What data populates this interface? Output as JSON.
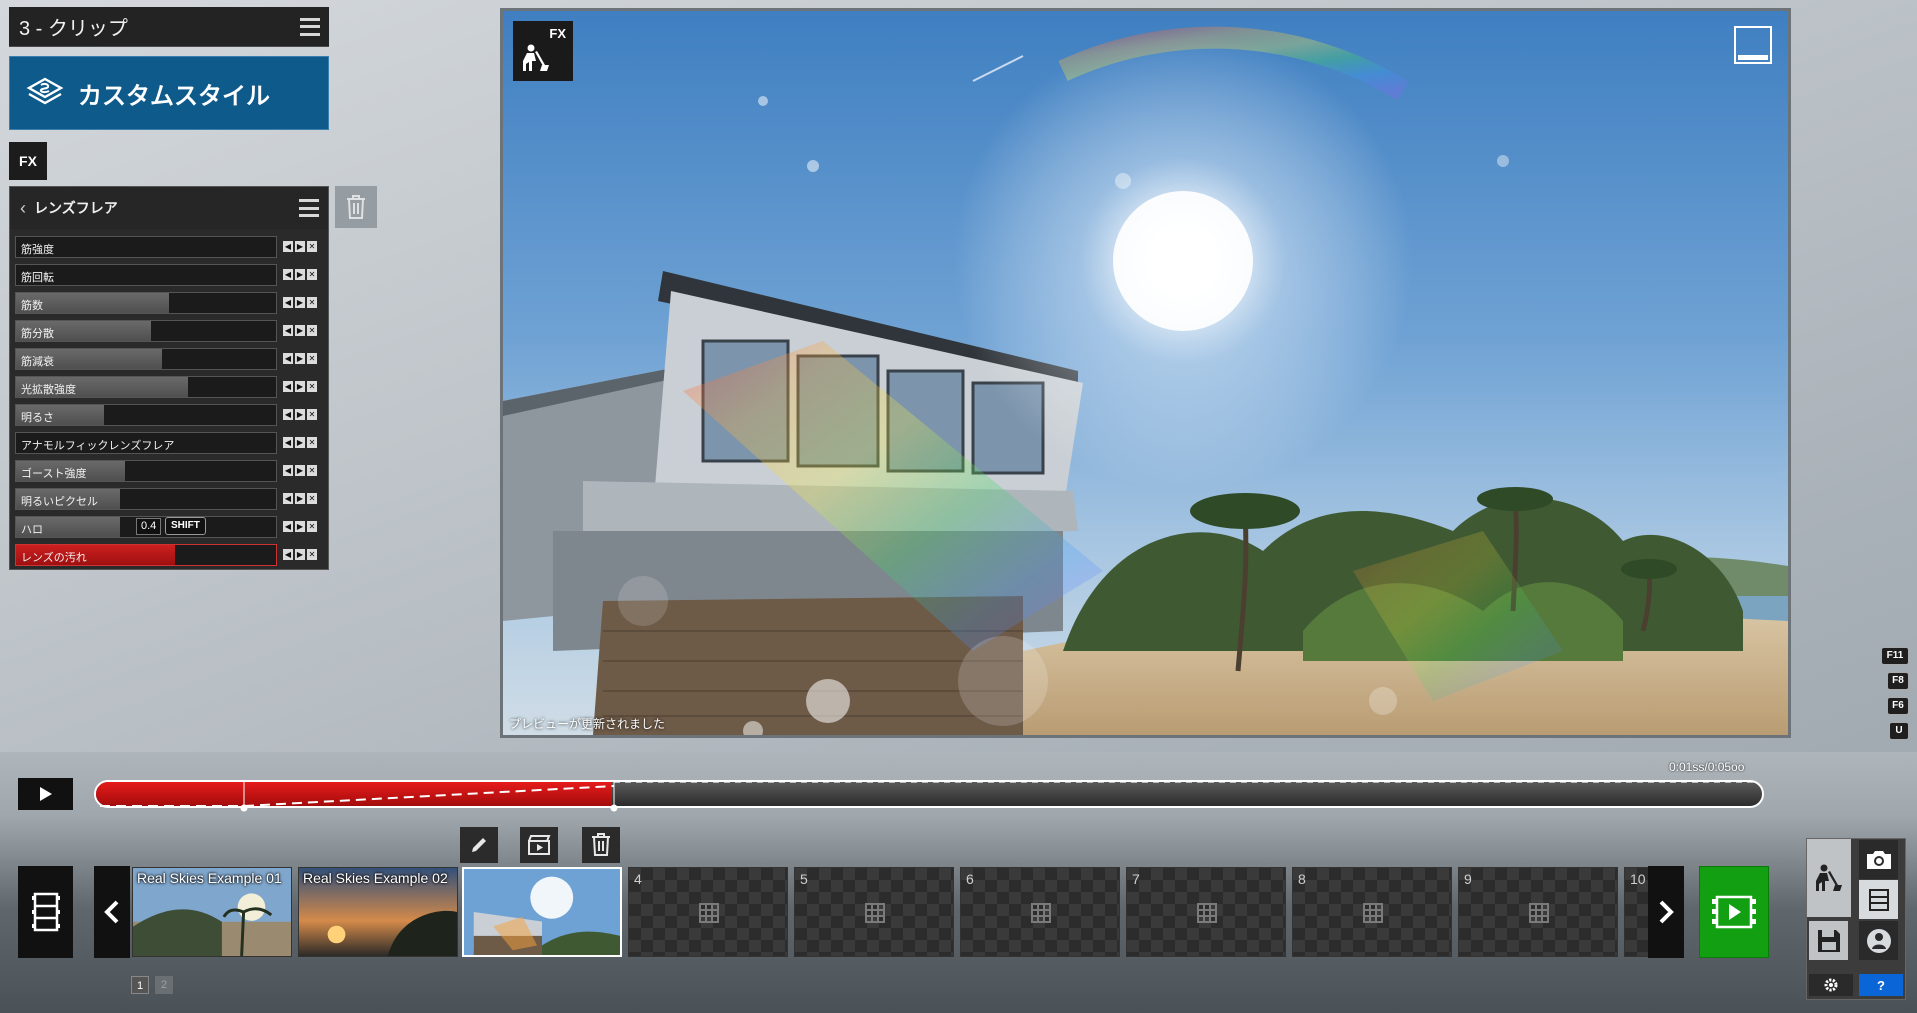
{
  "clip_header": {
    "title": "3 - クリップ"
  },
  "style_button": {
    "label": "カスタムスタイル"
  },
  "fx_tag": "FX",
  "lens_panel": {
    "title": "レンズフレア",
    "sliders": [
      {
        "label": "筋強度",
        "value": 0.0
      },
      {
        "label": "筋回転",
        "value": 0.0
      },
      {
        "label": "筋数",
        "value": 0.59
      },
      {
        "label": "筋分散",
        "value": 0.52
      },
      {
        "label": "筋減衰",
        "value": 0.56
      },
      {
        "label": "光拡散強度",
        "value": 0.66
      },
      {
        "label": "明るさ",
        "value": 0.34
      },
      {
        "label": "アナモルフィックレンズフレア",
        "value": 0.0
      },
      {
        "label": "ゴースト強度",
        "value": 0.42
      },
      {
        "label": "明るいピクセル",
        "value": 0.4
      },
      {
        "label": "ハロ",
        "value": 0.4,
        "value_text": "0.4",
        "shift_label": "SHIFT"
      },
      {
        "label": "レンズの汚れ",
        "value": 0.61,
        "active": true
      }
    ]
  },
  "preview": {
    "fx_label": "FX",
    "status": "プレビューが更新されました"
  },
  "shortcut_keys": [
    "F11",
    "F8",
    "F6",
    "U"
  ],
  "timeline": {
    "time_text": "0:01ss/0:05oo",
    "progress": 0.31
  },
  "clips": [
    {
      "caption": "Real Skies Example 01",
      "type": "image"
    },
    {
      "caption": "Real Skies Example 02",
      "type": "image"
    },
    {
      "caption": "",
      "type": "selected"
    },
    {
      "number": "4",
      "type": "empty"
    },
    {
      "number": "5",
      "type": "empty"
    },
    {
      "number": "6",
      "type": "empty"
    },
    {
      "number": "7",
      "type": "empty"
    },
    {
      "number": "8",
      "type": "empty"
    },
    {
      "number": "9",
      "type": "empty"
    },
    {
      "number": "10",
      "type": "empty"
    }
  ],
  "pages": [
    "1",
    "2"
  ],
  "mode_panel": {
    "help_label": "?"
  },
  "colors": {
    "accent_blue": "#0d5a8b",
    "active_red": "#cc1f1f",
    "render_green": "#12a012"
  }
}
